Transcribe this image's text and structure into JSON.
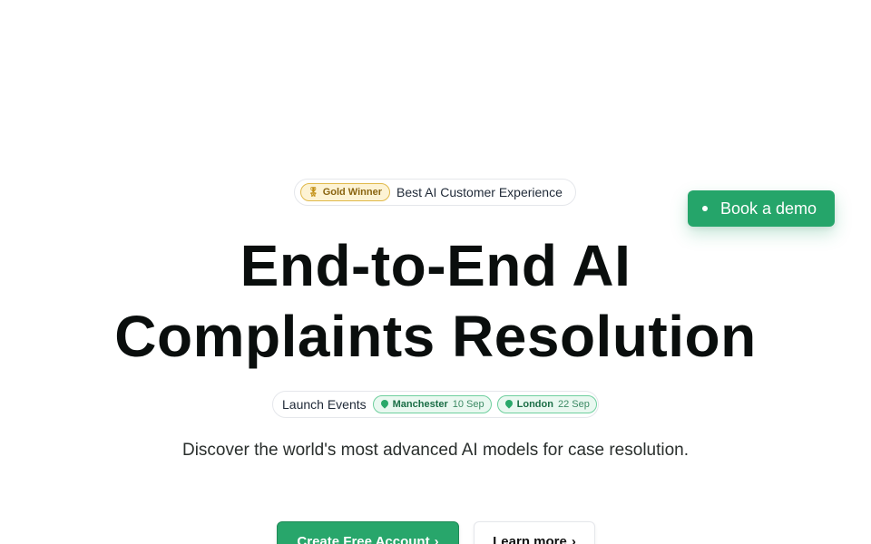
{
  "award": {
    "badge_icon": "medal-icon",
    "badge_glyph": "🎖",
    "badge_label": "Gold Winner",
    "text": "Best AI Customer Experience"
  },
  "demo_button": {
    "label": "Book a demo"
  },
  "headline": {
    "line1": "End-to-End AI",
    "line2": "Complaints Resolution"
  },
  "events": {
    "label": "Launch Events",
    "items": [
      {
        "city": "Manchester",
        "date": "10 Sep",
        "icon": "location-pin-icon"
      },
      {
        "city": "London",
        "date": "22 Sep",
        "icon": "location-pin-icon"
      }
    ]
  },
  "subtitle": "Discover the world's most advanced AI models for case resolution.",
  "cta": {
    "primary_label": "Create Free Account",
    "secondary_label": "Learn more",
    "chevron": "›"
  },
  "colors": {
    "brand_green": "#25a56a",
    "gold": "#e0b94a"
  }
}
